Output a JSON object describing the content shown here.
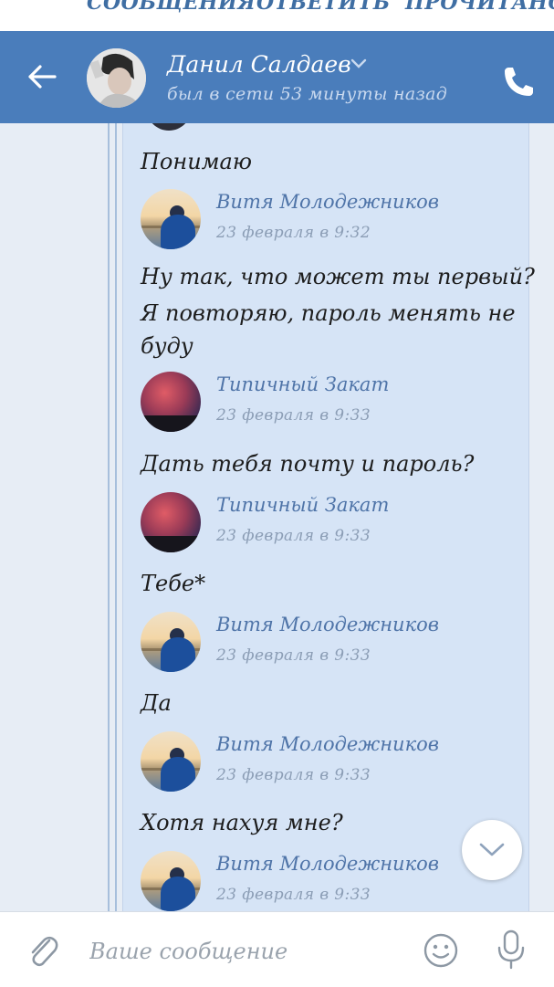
{
  "notification_actions": {
    "messages": "СООБЩЕНИЯ",
    "reply": "ОТВЕТИТЬ",
    "read": "ПРОЧИТАНО"
  },
  "header": {
    "name": "Данил Салдаев",
    "status": "был в сети 53 минуты назад"
  },
  "messages": [
    {
      "text": "Понимаю"
    },
    {
      "sender": "Витя Молодежников",
      "time": "23 февраля в 9:32"
    },
    {
      "text_lines": [
        "Ну так, что может ты первый?",
        "Я повторяю, пароль менять не",
        "буду"
      ]
    },
    {
      "sender": "Типичный Закат",
      "time": "23 февраля в 9:33"
    },
    {
      "text": "Дать тебя почту и пароль?"
    },
    {
      "sender": "Типичный Закат",
      "time": "23 февраля в 9:33"
    },
    {
      "text": "Тебе*"
    },
    {
      "sender": "Витя Молодежников",
      "time": "23 февраля в 9:33"
    },
    {
      "text": "Да"
    },
    {
      "sender": "Витя Молодежников",
      "time": "23 февраля в 9:33"
    },
    {
      "text": "Хотя нахуя мне?"
    },
    {
      "sender": "Витя Молодежников",
      "time": "23 февраля в 9:33"
    }
  ],
  "input": {
    "placeholder": "Ваше сообщение"
  },
  "colors": {
    "header_bg": "#4a7dbb",
    "card_bg": "#d6e4f6",
    "sender_name": "#4f74a8"
  },
  "icons": [
    "back-arrow-icon",
    "chevron-down-icon",
    "phone-icon",
    "scroll-down-chevron-icon",
    "paperclip-icon",
    "emoji-icon",
    "microphone-icon"
  ]
}
